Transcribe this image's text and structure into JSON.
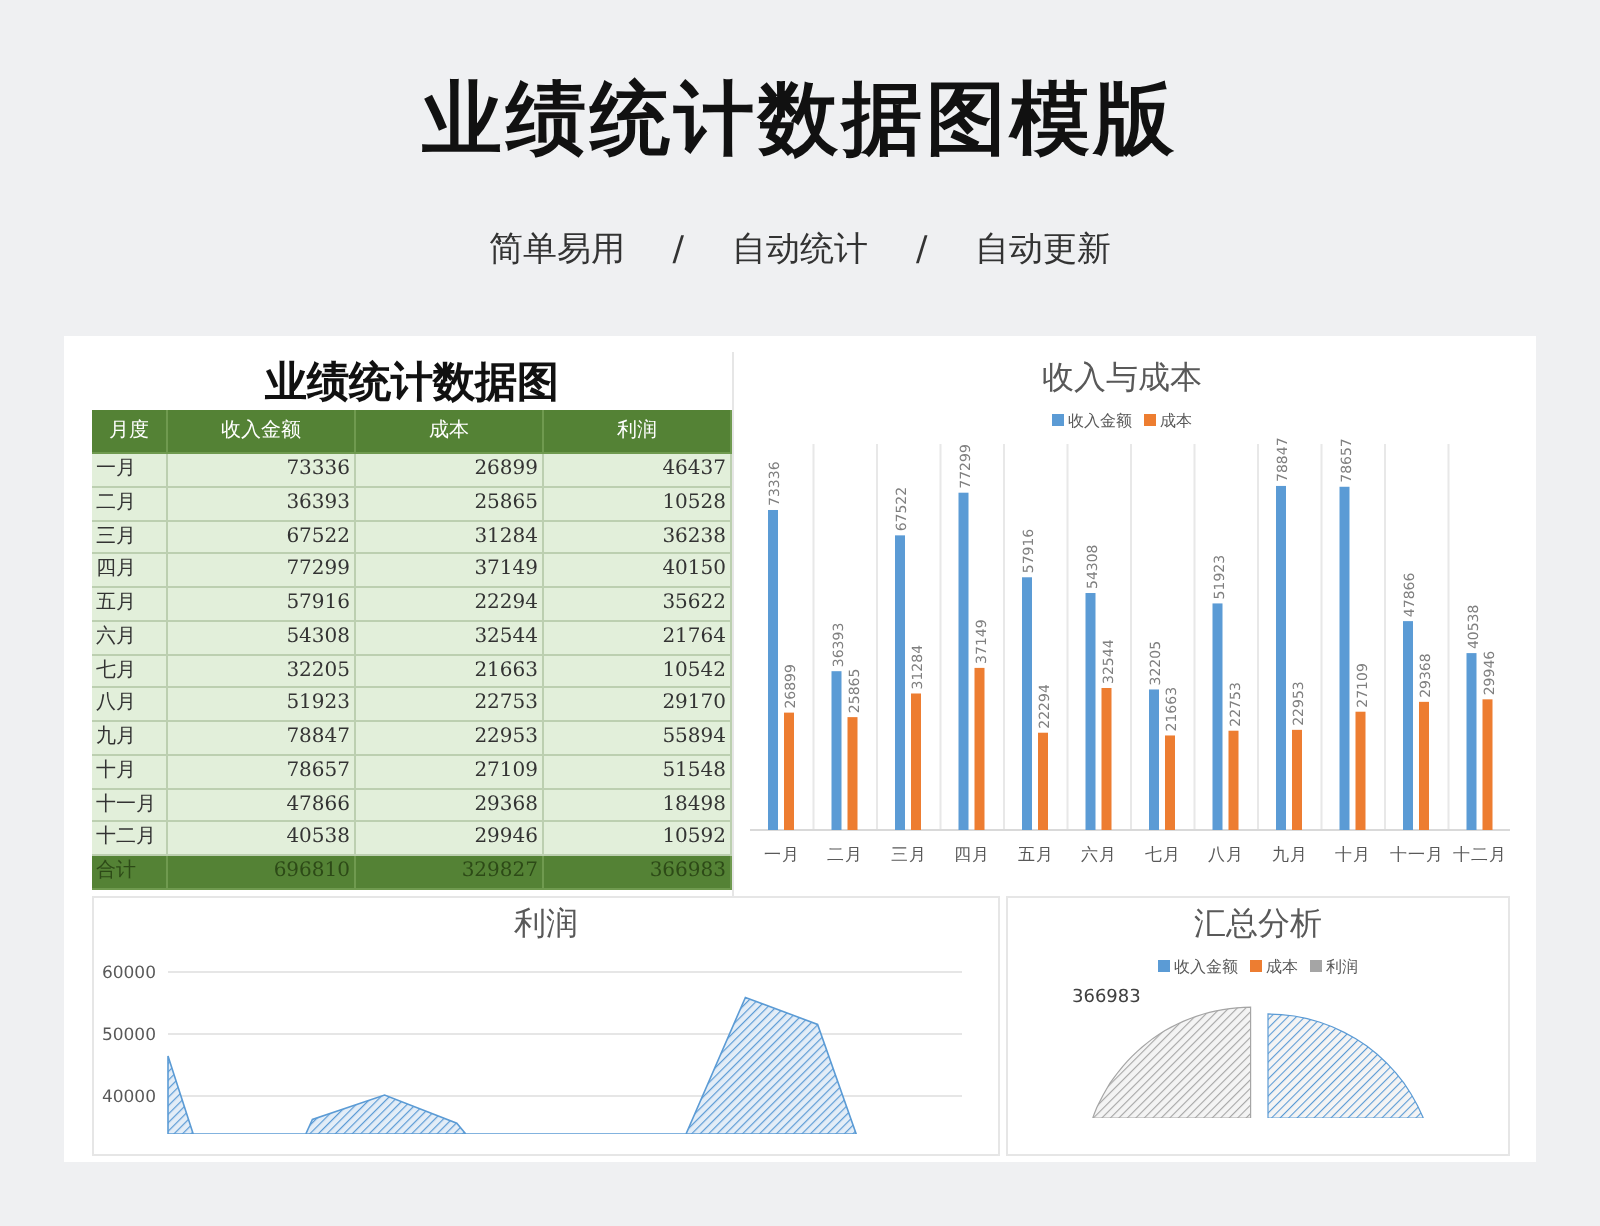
{
  "page": {
    "title": "业绩统计数据图模版",
    "tagline": [
      "简单易用",
      "/",
      "自动统计",
      "/",
      "自动更新"
    ]
  },
  "table": {
    "title": "业绩统计数据图",
    "columns": [
      "月度",
      "收入金额",
      "成本",
      "利润"
    ],
    "rows": [
      [
        "一月",
        "73336",
        "26899",
        "46437"
      ],
      [
        "二月",
        "36393",
        "25865",
        "10528"
      ],
      [
        "三月",
        "67522",
        "31284",
        "36238"
      ],
      [
        "四月",
        "77299",
        "37149",
        "40150"
      ],
      [
        "五月",
        "57916",
        "22294",
        "35622"
      ],
      [
        "六月",
        "54308",
        "32544",
        "21764"
      ],
      [
        "七月",
        "32205",
        "21663",
        "10542"
      ],
      [
        "八月",
        "51923",
        "22753",
        "29170"
      ],
      [
        "九月",
        "78847",
        "22953",
        "55894"
      ],
      [
        "十月",
        "78657",
        "27109",
        "51548"
      ],
      [
        "十一月",
        "47866",
        "29368",
        "18498"
      ],
      [
        "十二月",
        "40538",
        "29946",
        "10592"
      ]
    ],
    "total": [
      "合计",
      "696810",
      "329827",
      "366983"
    ]
  },
  "bar_chart": {
    "chart_data": {
      "type": "bar",
      "title": "收入与成本",
      "categories": [
        "一月",
        "二月",
        "三月",
        "四月",
        "五月",
        "六月",
        "七月",
        "八月",
        "九月",
        "十月",
        "十一月",
        "十二月"
      ],
      "series": [
        {
          "name": "收入金额",
          "color": "#5b9bd5",
          "values": [
            73336,
            36393,
            67522,
            77299,
            57916,
            54308,
            32205,
            51923,
            78847,
            78657,
            47866,
            40538
          ]
        },
        {
          "name": "成本",
          "color": "#ed7d31",
          "values": [
            26899,
            25865,
            31284,
            37149,
            22294,
            32544,
            21663,
            22753,
            22953,
            27109,
            29368,
            29946
          ]
        }
      ],
      "data_labels": true,
      "legend": "top"
    }
  },
  "area_chart": {
    "title": "利润",
    "y_axis_labels": [
      "60000",
      "50000",
      "40000"
    ]
  },
  "pie_chart": {
    "title": "汇总分析",
    "legend": [
      {
        "label": "收入金额",
        "color": "#5b9bd5"
      },
      {
        "label": "成本",
        "color": "#ed7d31"
      },
      {
        "label": "利润",
        "color": "#a5a5a5"
      }
    ],
    "value_label": "366983"
  }
}
